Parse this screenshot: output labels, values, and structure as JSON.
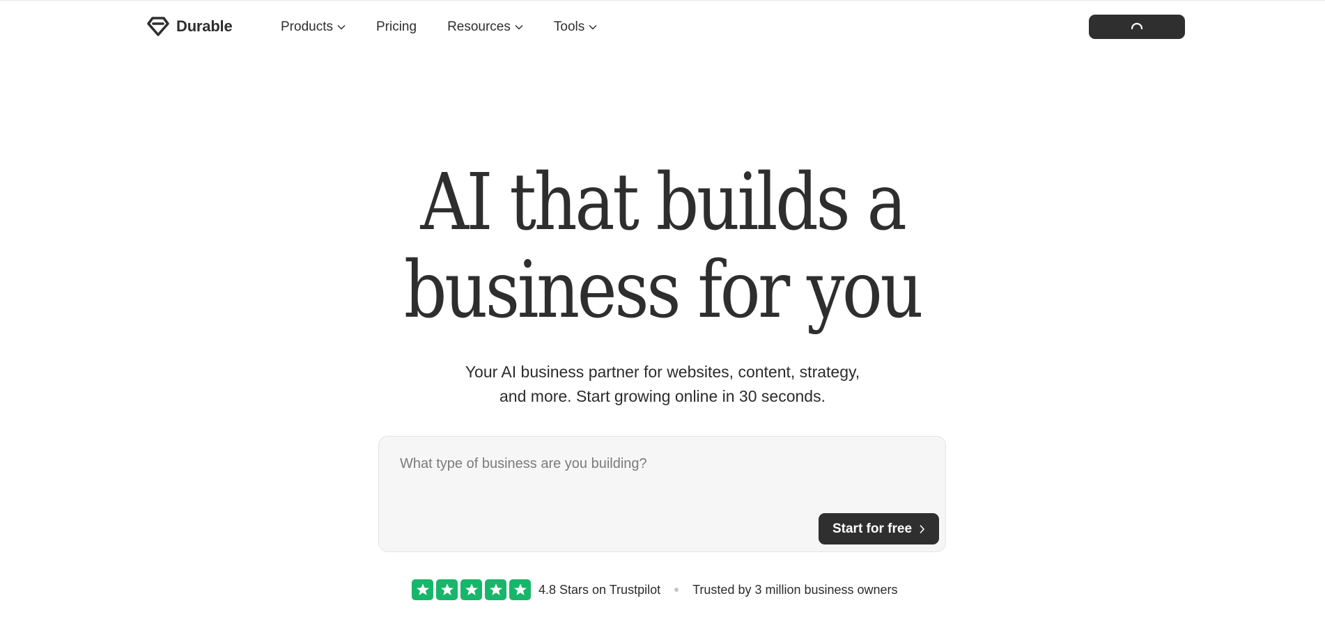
{
  "brand": {
    "name": "Durable",
    "logo_icon": "diamond-logo-icon"
  },
  "nav": {
    "items": [
      {
        "label": "Products",
        "has_dropdown": true
      },
      {
        "label": "Pricing",
        "has_dropdown": false
      },
      {
        "label": "Resources",
        "has_dropdown": true
      },
      {
        "label": "Tools",
        "has_dropdown": true
      }
    ],
    "cta_state": "loading",
    "cta_icon": "spinner-icon"
  },
  "hero": {
    "title_line1": "AI that builds a",
    "title_line2": "business for you",
    "subtitle_line1": "Your AI business partner for websites, content, strategy,",
    "subtitle_line2": "and more. Start growing online in 30 seconds."
  },
  "prompt": {
    "placeholder": "What type of business are you building?",
    "value": "",
    "button_label": "Start for free",
    "button_icon": "chevron-right-icon"
  },
  "trust": {
    "stars": 5,
    "star_color": "#18b66a",
    "rating_text": "4.8 Stars on Trustpilot",
    "trusted_text": "Trusted by 3 million business owners"
  },
  "colors": {
    "primary_dark": "#2f2f2f",
    "text": "#2b2b2b",
    "input_bg": "#f6f6f6",
    "accent_green": "#18b66a"
  }
}
